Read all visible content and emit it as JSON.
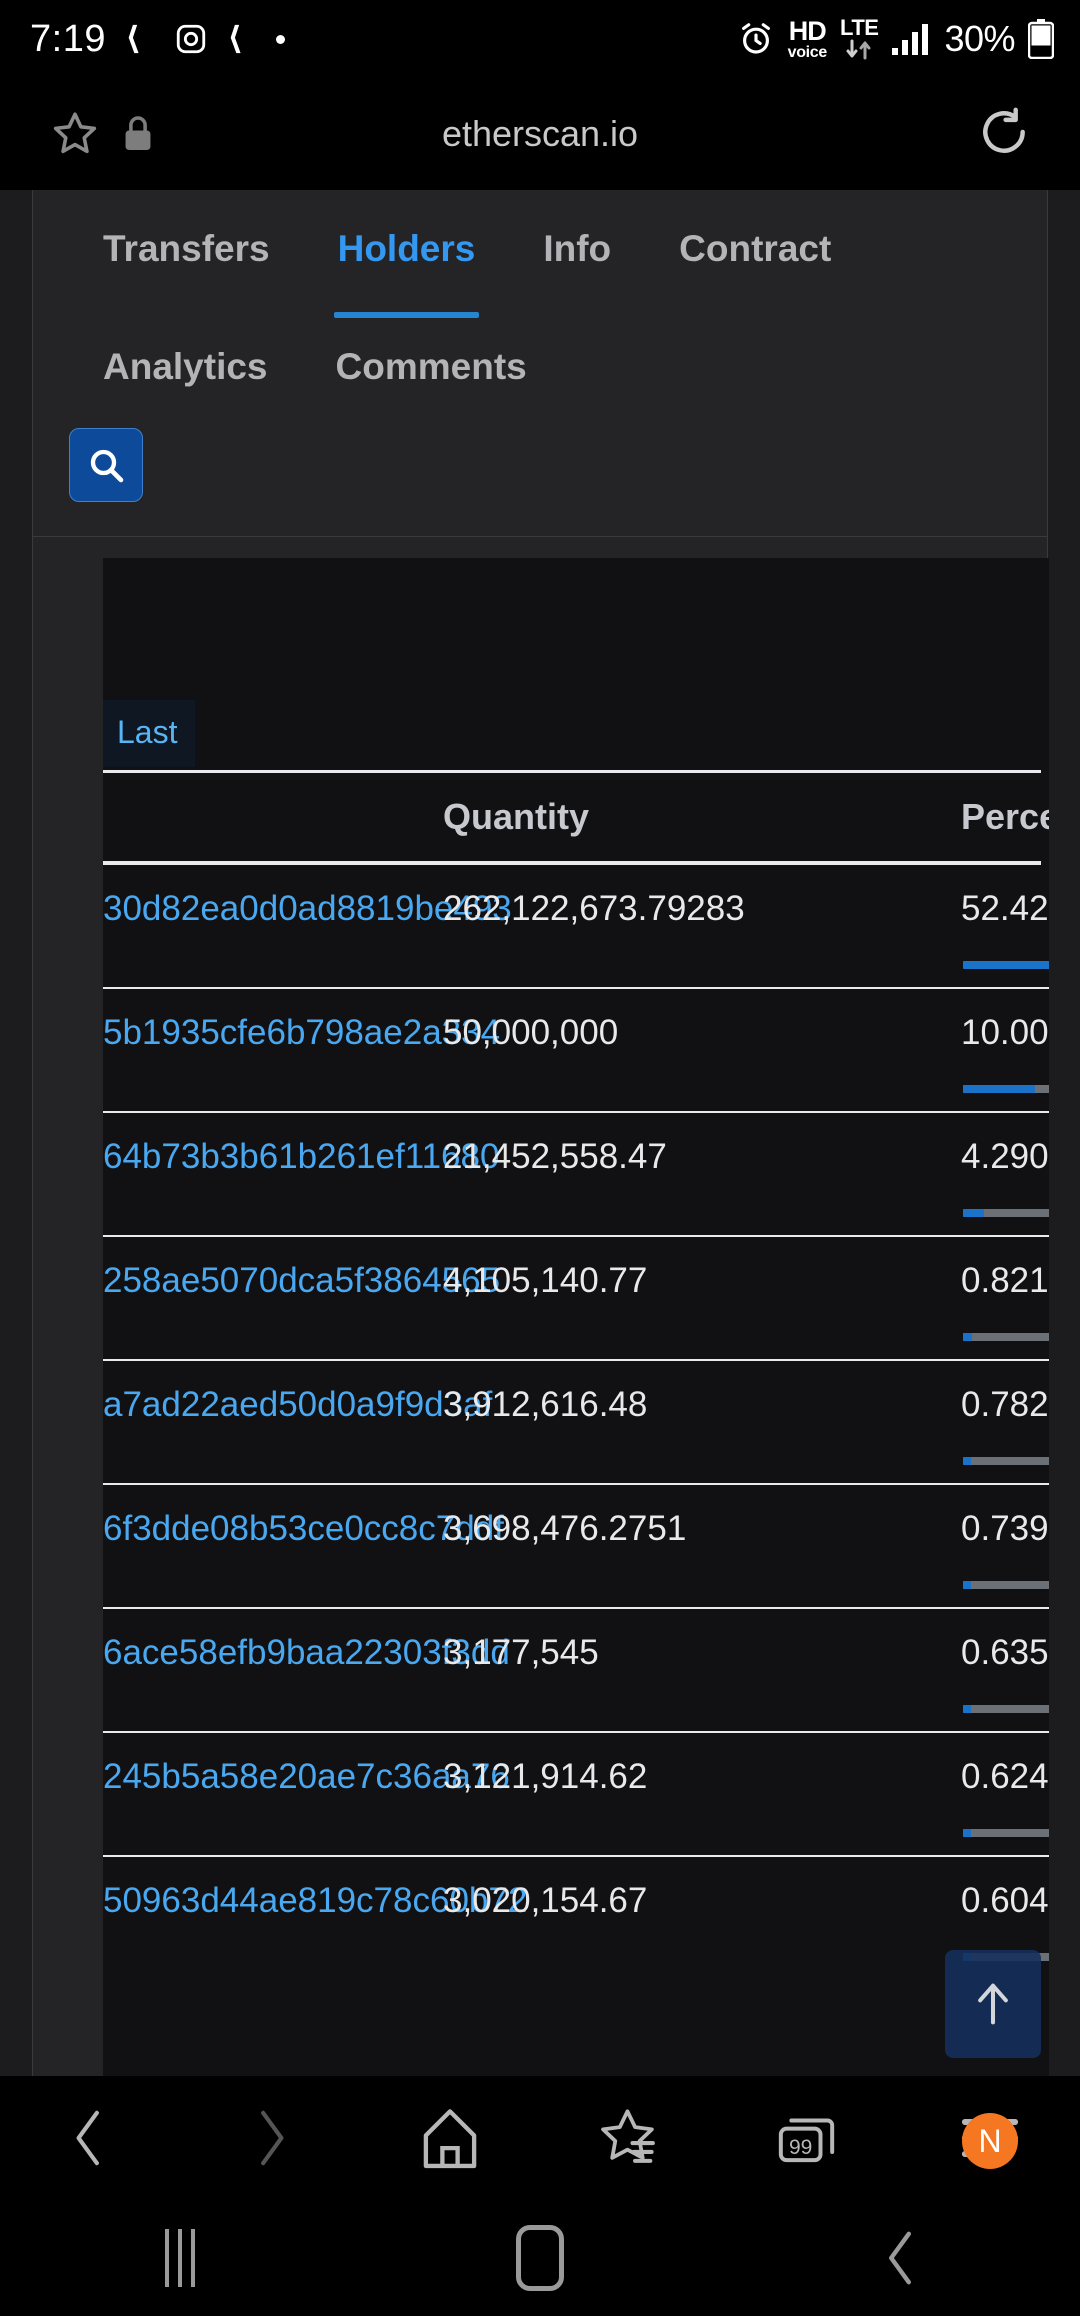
{
  "status_bar": {
    "time": "7:19",
    "icons": [
      "keep-icon",
      "instagram-icon",
      "keep-icon",
      "dot-icon"
    ],
    "alarm": "alarm-icon",
    "hd": "HD",
    "voice": "voice",
    "lte": "LTE",
    "battery_percent": "30%"
  },
  "browser": {
    "url": "etherscan.io",
    "bookmark_icon": "star-icon",
    "lock_icon": "lock-icon",
    "reload_icon": "reload-icon",
    "toolbar": {
      "back": "back-chevron-icon",
      "forward": "forward-chevron-icon",
      "home": "home-icon",
      "bookmarks": "bookmarks-star-icon",
      "tabs_count": "99",
      "menu": "menu-icon",
      "menu_badge": "N"
    },
    "system_nav": {
      "recents": "recents-icon",
      "home": "home-circle-icon",
      "back": "back-icon"
    }
  },
  "tabs": [
    {
      "label": "Transfers",
      "active": false
    },
    {
      "label": "Holders",
      "active": true
    },
    {
      "label": "Info",
      "active": false
    },
    {
      "label": "Contract",
      "active": false
    },
    {
      "label": "Analytics",
      "active": false
    },
    {
      "label": "Comments",
      "active": false
    }
  ],
  "search": {
    "icon": "search-icon"
  },
  "pagination": {
    "last_label": "Last"
  },
  "table": {
    "columns": [
      "Quantity",
      "Perce"
    ],
    "rows": [
      {
        "address": "30d82ea0d0ad8819be493",
        "quantity": "262,122,673.79283",
        "percentage": "52.42",
        "bar_pct": 100
      },
      {
        "address": "5b1935cfe6b798ae2a334",
        "quantity": "50,000,000",
        "percentage": "10.00",
        "bar_pct": 48
      },
      {
        "address": "64b73b3b61b261ef11680",
        "quantity": "21,452,558.47",
        "percentage": "4.290",
        "bar_pct": 14
      },
      {
        "address": "258ae5070dca5f3864565",
        "quantity": "4,105,140.77",
        "percentage": "0.821",
        "bar_pct": 6
      },
      {
        "address": "a7ad22aed50d0a9f9d3af",
        "quantity": "3,912,616.48",
        "percentage": "0.782",
        "bar_pct": 5
      },
      {
        "address": "6f3dde08b53ce0cc8c7ddf",
        "quantity": "3,698,476.2751",
        "percentage": "0.739",
        "bar_pct": 5
      },
      {
        "address": "6ace58efb9baa22303f3dd",
        "quantity": "3,177,545",
        "percentage": "0.635",
        "bar_pct": 5
      },
      {
        "address": "245b5a58e20ae7c36aa76",
        "quantity": "3,121,914.62",
        "percentage": "0.624",
        "bar_pct": 5
      },
      {
        "address": "50963d44ae819c78c60b72",
        "quantity": "3,020,154.67",
        "percentage": "0.604",
        "bar_pct": 5
      }
    ]
  },
  "scroll_top": {
    "icon": "arrow-up-icon"
  },
  "colors": {
    "accent_blue": "#3498f0",
    "link_blue": "#4aa8f0",
    "bar_blue": "#1a73c8",
    "button_blue": "#0d4a99",
    "badge_orange": "#f57722",
    "page_bg": "#1c1c1e",
    "card_bg": "#242427",
    "table_bg": "#111113"
  }
}
